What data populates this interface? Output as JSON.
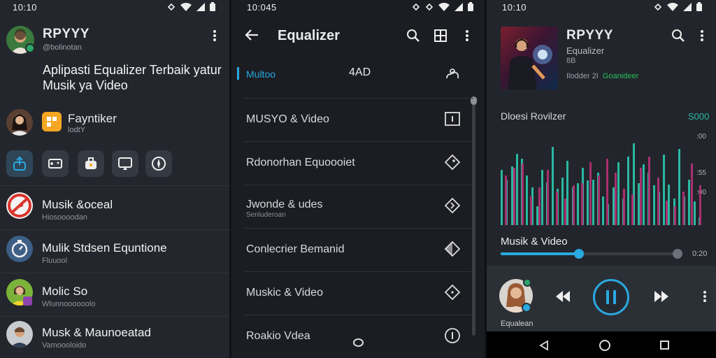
{
  "colors": {
    "accent": "#2aa9e0",
    "teal": "#2ab8a2",
    "magenta": "#a8306f",
    "green_text": "#27c15b"
  },
  "p1": {
    "status_time": "10:10",
    "profile": {
      "name": "RPYYY",
      "handle": "@bolinotan"
    },
    "headline": "Aplipasti Equalizer Terbaik yatur Musik ya Video",
    "featured": {
      "title": "Fayntiker",
      "sub": "lodtY"
    },
    "quick_actions": [
      "share-icon",
      "gamepad-icon",
      "briefcase-icon",
      "cast-icon",
      "compass-icon"
    ],
    "list": [
      {
        "title": "Musik &oceal",
        "sub": "Hiosoooodan",
        "icon": "no-music-icon"
      },
      {
        "title": "Mulik Stdsen Equntione",
        "sub": "Fluuool",
        "icon": "timer-icon"
      },
      {
        "title": "Molic So",
        "sub": "Wlunnoooooolo",
        "icon": "avatar"
      },
      {
        "title": "Musk & Maunoeatad",
        "sub": "Vamoooloido",
        "icon": "avatar"
      }
    ]
  },
  "p2": {
    "status_time": "10:045",
    "title": "Equalizer",
    "rows": [
      {
        "label": "Multoo",
        "value": "4AD",
        "icon": "cloud-sound-icon"
      },
      {
        "label": "MUSYO & Video",
        "icon": "info-box-icon"
      },
      {
        "label": "Rdonorhan Equoooiet",
        "icon": "diamond-tag-icon"
      },
      {
        "label": "Jwonde & udes",
        "sub": "Senluderoan",
        "icon": "diamond-nav-icon"
      },
      {
        "label": "Conlecrier Bemanid",
        "icon": "diamond-half-icon"
      },
      {
        "label": "Muskic & Video",
        "icon": "diamond-dots-icon"
      },
      {
        "label": "Roakio Vdea",
        "icon": "circle-info-icon"
      }
    ]
  },
  "p3": {
    "status_time": "10:10",
    "now": {
      "title": "RPYYY",
      "subtitle": "Equalizer",
      "meta1": "8B",
      "meta2": "Ilodder 2I",
      "meta3": "Goanideer"
    },
    "viz": {
      "title": "Dloesi Rovilzer",
      "value": "S000",
      "axis": [
        ":00",
        ":55",
        ":00"
      ]
    },
    "track": {
      "label": "Musik & Video",
      "progress": 0.44,
      "time": "0:20"
    },
    "player": {
      "caption": "Equalean"
    }
  },
  "chart_data": {
    "type": "bar",
    "title": "Dloesi Rovilzer",
    "ylabels": [
      ":00",
      ":55",
      ":00"
    ],
    "series": [
      {
        "color": "teal",
        "values": [
          58,
          48,
          62,
          75,
          70,
          52,
          40,
          20,
          58,
          45,
          82,
          38,
          50,
          68,
          40,
          44,
          60,
          47,
          48,
          55,
          30,
          22,
          40,
          66,
          28,
          72,
          86,
          44,
          64,
          55,
          42,
          35,
          74,
          43,
          28,
          80,
          30,
          48,
          25,
          8
        ]
      },
      {
        "color": "magenta",
        "values": [
          52,
          60,
          65,
          30,
          40,
          58,
          35,
          28,
          42,
          44,
          66,
          52,
          70,
          55,
          38,
          32,
          60,
          72,
          50,
          26,
          20,
          35,
          65,
          42
        ]
      }
    ]
  },
  "nav": {
    "back": "back-icon",
    "home": "home-icon",
    "recents": "recents-icon"
  }
}
